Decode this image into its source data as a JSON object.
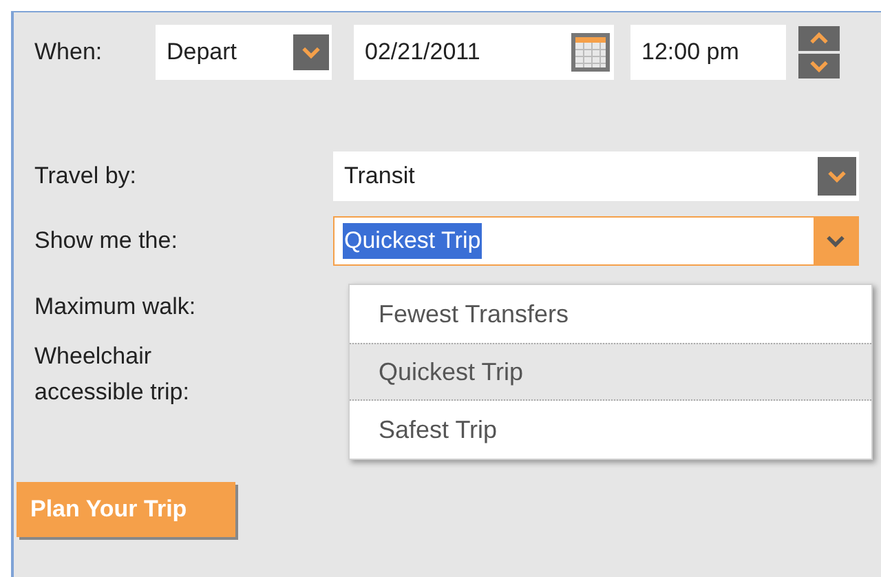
{
  "when": {
    "label": "When:",
    "mode": "Depart",
    "date": "02/21/2011",
    "time": "12:00 pm"
  },
  "travel_by": {
    "label": "Travel by:",
    "value": "Transit"
  },
  "show_me": {
    "label": "Show me the:",
    "value": "Quickest Trip",
    "expanded": true,
    "options": [
      {
        "label": "Fewest Transfers",
        "selected": false
      },
      {
        "label": "Quickest Trip",
        "selected": true
      },
      {
        "label": "Safest Trip",
        "selected": false
      }
    ]
  },
  "maximum_walk": {
    "label": "Maximum walk:"
  },
  "wheelchair": {
    "label": "Wheelchair accessible trip:"
  },
  "plan_button": "Plan Your Trip"
}
